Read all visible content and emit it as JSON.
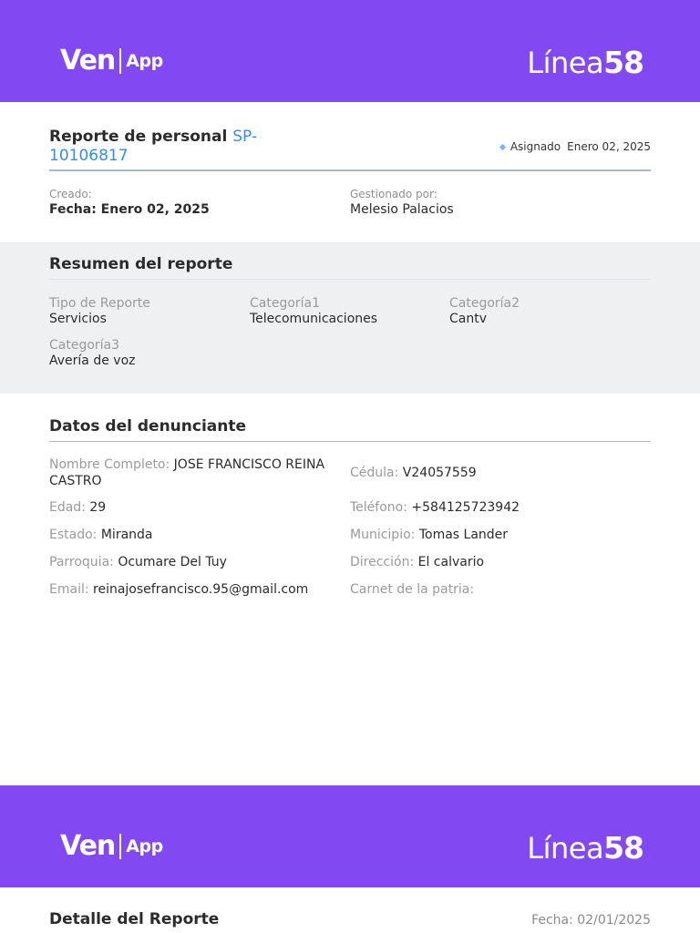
{
  "brand": {
    "ven": "Ven",
    "app": "App",
    "linea": "Línea",
    "linea_num": "58",
    "band_color": "#8249f3"
  },
  "report": {
    "title": "Reporte de personal",
    "code": "SP-10106817",
    "assigned_label": "Asignado",
    "assigned_date": "Enero 02, 2025",
    "created_label": "Creado:",
    "created_value": "Fecha: Enero 02, 2025",
    "managed_label": "Gestionado por:",
    "managed_value": "Melesio Palacios"
  },
  "summary": {
    "title": "Resumen del reporte",
    "items": [
      {
        "label": "Tipo de Reporte",
        "value": "Servicios"
      },
      {
        "label": "Categoría1",
        "value": "Telecomunicaciones"
      },
      {
        "label": "Categoría2",
        "value": "Cantv"
      },
      {
        "label": "Categoría3",
        "value": "Avería de voz"
      }
    ]
  },
  "complainant": {
    "title": "Datos del denunciante",
    "fields": [
      {
        "label": "Nombre Completo:",
        "value": "JOSE FRANCISCO REINA CASTRO"
      },
      {
        "label": "Cédula:",
        "value": "V24057559"
      },
      {
        "label": "Edad:",
        "value": "29"
      },
      {
        "label": "Teléfono:",
        "value": "+584125723942"
      },
      {
        "label": "Estado:",
        "value": "Miranda"
      },
      {
        "label": "Municipio:",
        "value": "Tomas Lander"
      },
      {
        "label": "Parroquia:",
        "value": "Ocumare Del Tuy"
      },
      {
        "label": "Dirección:",
        "value": "El calvario"
      },
      {
        "label": "Email:",
        "value": "reinajosefrancisco.95@gmail.com"
      },
      {
        "label": "Carnet de la patria:",
        "value": ""
      }
    ]
  },
  "detail": {
    "title": "Detalle del Reporte",
    "date": "Fecha: 02/01/2025"
  }
}
